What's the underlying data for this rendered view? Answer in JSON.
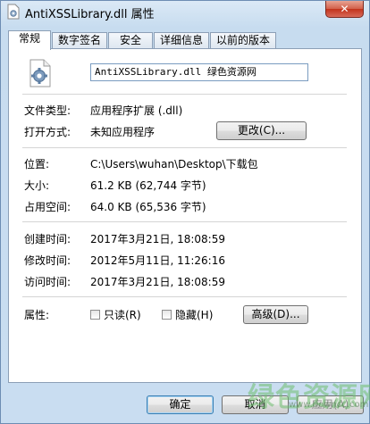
{
  "window": {
    "title": "AntiXSSLibrary.dll 属性",
    "close_label": "✕"
  },
  "tabs": [
    {
      "label": "常规"
    },
    {
      "label": "数字签名"
    },
    {
      "label": "安全"
    },
    {
      "label": "详细信息"
    },
    {
      "label": "以前的版本"
    }
  ],
  "general": {
    "filename": "AntiXSSLibrary.dll 绿色资源网",
    "file_type_label": "文件类型:",
    "file_type_value": "应用程序扩展 (.dll)",
    "open_with_label": "打开方式:",
    "open_with_value": "未知应用程序",
    "change_button": "更改(C)...",
    "location_label": "位置:",
    "location_value": "C:\\Users\\wuhan\\Desktop\\下载包",
    "size_label": "大小:",
    "size_value": "61.2 KB (62,744 字节)",
    "size_on_disk_label": "占用空间:",
    "size_on_disk_value": "64.0 KB (65,536 字节)",
    "created_label": "创建时间:",
    "created_value": "2017年3月21日, 18:08:59",
    "modified_label": "修改时间:",
    "modified_value": "2012年5月11日, 11:26:16",
    "accessed_label": "访问时间:",
    "accessed_value": "2017年3月21日, 18:08:59",
    "attributes_label": "属性:",
    "readonly_label": "只读(R)",
    "hidden_label": "隐藏(H)",
    "advanced_button": "高级(D)..."
  },
  "footer": {
    "ok": "确定",
    "cancel": "取消",
    "apply": "应用(A)"
  },
  "watermark": {
    "text": "绿色资源网",
    "sub": "www.downcc.com"
  },
  "icons": {
    "title": "dll-file-icon",
    "file": "gear-file-icon"
  }
}
